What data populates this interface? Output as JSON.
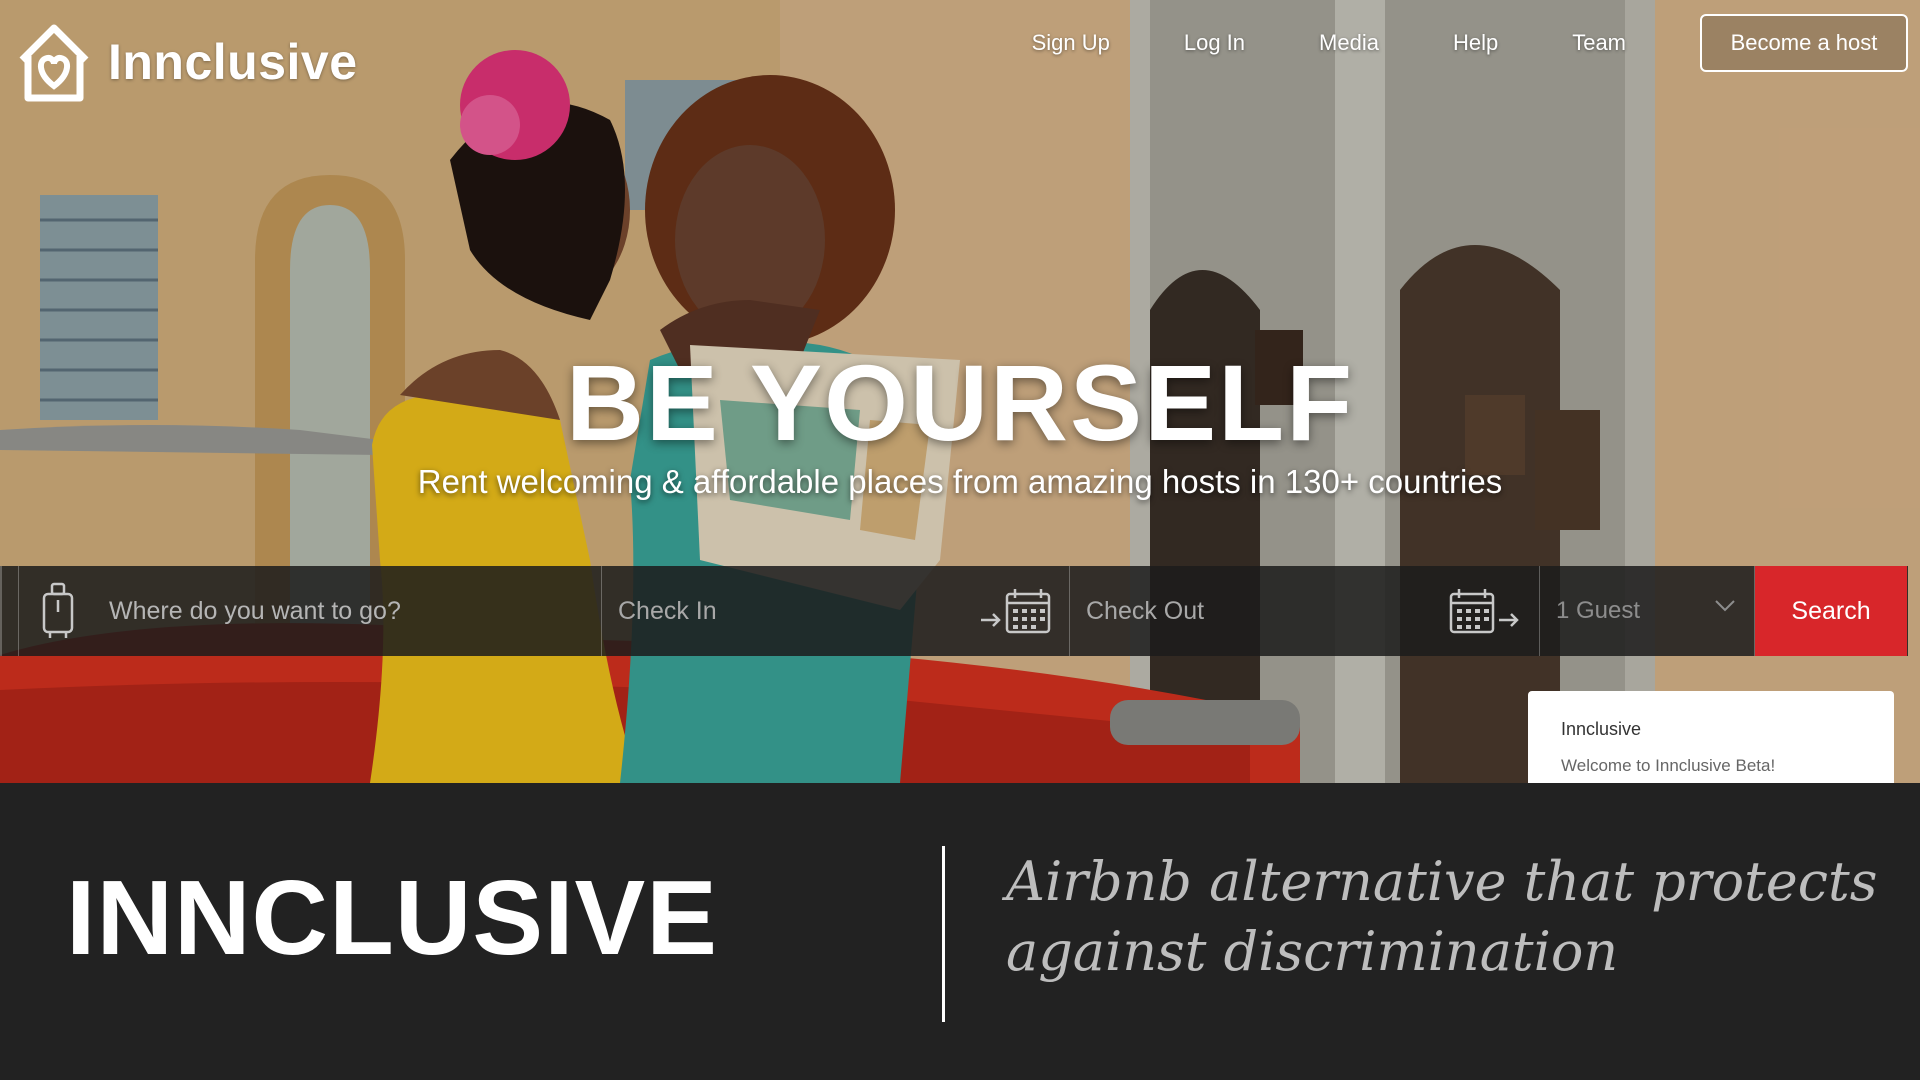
{
  "brand": {
    "name": "Innclusive"
  },
  "nav": {
    "links": [
      "Sign Up",
      "Log In",
      "Media",
      "Help",
      "Team"
    ],
    "host_button": "Become a host"
  },
  "hero": {
    "headline": "BE YOURSELF",
    "subheadline": "Rent welcoming & affordable places from amazing hosts in 130+ countries"
  },
  "search": {
    "where_placeholder": "Where do you want to go?",
    "check_in_placeholder": "Check In",
    "check_out_placeholder": "Check Out",
    "guests_value": "1 Guest",
    "button_label": "Search",
    "accent_color": "#d8262a"
  },
  "notification": {
    "title": "Innclusive",
    "body": "Welcome to Innclusive Beta!"
  },
  "caption": {
    "title": "INNCLUSIVE",
    "tagline": "Airbnb alternative that protects against discrimination"
  }
}
